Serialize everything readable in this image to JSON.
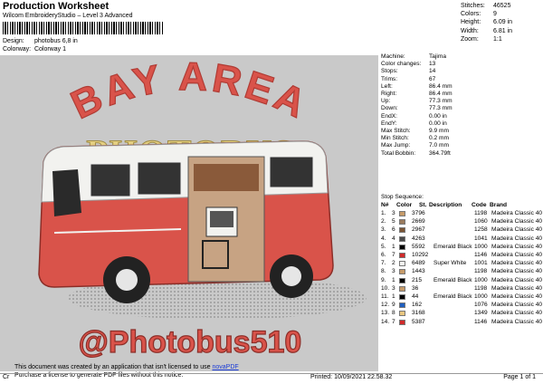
{
  "header": {
    "title": "Production Worksheet",
    "subtitle": "Wilcom EmbroideryStudio – Level 3 Advanced",
    "design_label": "Design:",
    "design_value": "photobus 6,8 in",
    "colorway_label": "Colorway:",
    "colorway_value": "Colorway 1"
  },
  "stats": [
    {
      "k": "Stitches:",
      "v": "46525"
    },
    {
      "k": "Colors:",
      "v": "9"
    },
    {
      "k": "Height:",
      "v": "6.09 in"
    },
    {
      "k": "Width:",
      "v": "6.81 in"
    },
    {
      "k": "Zoom:",
      "v": "1:1"
    }
  ],
  "design_text": {
    "top": "BAY AREA",
    "middle": "PHOTOBUS",
    "bottom": "@Photobus510"
  },
  "colors": {
    "red": "#d9534a",
    "red_dark": "#b03c35",
    "gold": "#e4cf82",
    "white": "#f2f2ef",
    "black": "#222222",
    "tan": "#c7a383",
    "brown": "#8a5a3a"
  },
  "machine": [
    {
      "k": "Machine:",
      "v": "Tajima"
    },
    {
      "k": "Color changes:",
      "v": "13"
    },
    {
      "k": "Stops:",
      "v": "14"
    },
    {
      "k": "Trims:",
      "v": "67"
    },
    {
      "k": "Left:",
      "v": "86.4 mm"
    },
    {
      "k": "Right:",
      "v": "86.4 mm"
    },
    {
      "k": "Up:",
      "v": "77.3 mm"
    },
    {
      "k": "Down:",
      "v": "77.3 mm"
    },
    {
      "k": "EndX:",
      "v": "0.00 in"
    },
    {
      "k": "EndY:",
      "v": "0.00 in"
    },
    {
      "k": "Max Stitch:",
      "v": "9.9 mm"
    },
    {
      "k": "Min Stitch:",
      "v": "0.2 mm"
    },
    {
      "k": "Max Jump:",
      "v": "7.0 mm"
    },
    {
      "k": "Total Bobbin:",
      "v": "364.79ft"
    }
  ],
  "sequence": {
    "title": "Stop Sequence:",
    "columns": {
      "n": "N#",
      "color": "Color",
      "st": "St.",
      "desc": "Description",
      "code": "Code",
      "brand": "Brand"
    },
    "rows": [
      {
        "n": "1.",
        "c": "3",
        "color": "#c69b6a",
        "num": "3796",
        "desc": "",
        "st": "1198",
        "brand": "Madeira Classic 40"
      },
      {
        "n": "2.",
        "c": "5",
        "color": "#9a7b5e",
        "num": "2669",
        "desc": "",
        "st": "1060",
        "brand": "Madeira Classic 40"
      },
      {
        "n": "3.",
        "c": "6",
        "color": "#7a5535",
        "num": "2967",
        "desc": "",
        "st": "1258",
        "brand": "Madeira Classic 40"
      },
      {
        "n": "4.",
        "c": "4",
        "color": "#4a4a4a",
        "num": "4263",
        "desc": "",
        "st": "1041",
        "brand": "Madeira Classic 40"
      },
      {
        "n": "5.",
        "c": "1",
        "color": "#000000",
        "num": "5592",
        "desc": "Emerald Black",
        "st": "1000",
        "brand": "Madeira Classic 40"
      },
      {
        "n": "6.",
        "c": "7",
        "color": "#d02a2a",
        "num": "10292",
        "desc": "",
        "st": "1146",
        "brand": "Madeira Classic 40"
      },
      {
        "n": "7.",
        "c": "2",
        "color": "#f4f4f0",
        "num": "6489",
        "desc": "Super White",
        "st": "1001",
        "brand": "Madeira Classic 40"
      },
      {
        "n": "8.",
        "c": "3",
        "color": "#c69b6a",
        "num": "1443",
        "desc": "",
        "st": "1198",
        "brand": "Madeira Classic 40"
      },
      {
        "n": "9.",
        "c": "1",
        "color": "#000000",
        "num": "215",
        "desc": "Emerald Black",
        "st": "1000",
        "brand": "Madeira Classic 40"
      },
      {
        "n": "10.",
        "c": "3",
        "color": "#c69b6a",
        "num": "36",
        "desc": "",
        "st": "1198",
        "brand": "Madeira Classic 40"
      },
      {
        "n": "11.",
        "c": "1",
        "color": "#000000",
        "num": "44",
        "desc": "Emerald Black",
        "st": "1000",
        "brand": "Madeira Classic 40"
      },
      {
        "n": "12.",
        "c": "9",
        "color": "#1f5fbf",
        "num": "162",
        "desc": "",
        "st": "1076",
        "brand": "Madeira Classic 40"
      },
      {
        "n": "13.",
        "c": "8",
        "color": "#e8c680",
        "num": "3168",
        "desc": "",
        "st": "1349",
        "brand": "Madeira Classic 40"
      },
      {
        "n": "14.",
        "c": "7",
        "color": "#d02a2a",
        "num": "5387",
        "desc": "",
        "st": "1146",
        "brand": "Madeira Classic 40"
      }
    ]
  },
  "notice": {
    "line1": "This document was created by an application that isn't licensed to use",
    "link": "novaPDF",
    "line2": "Purchase a license to generate PDF files without this notice."
  },
  "footer": {
    "cr": "Cr",
    "printed": "Printed: 10/09/2021 22.58.32",
    "page": "Page 1 of 1"
  }
}
